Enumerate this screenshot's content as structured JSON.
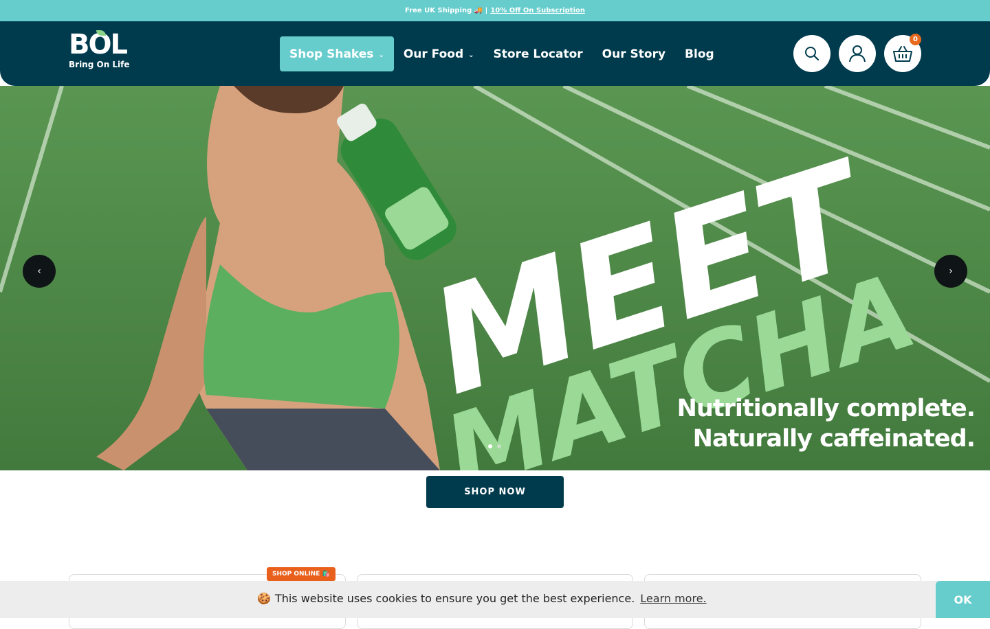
{
  "announcement": {
    "shipping": "Free UK Shipping 🚚 |",
    "subscription_link": "10% Off On Subscription"
  },
  "logo": {
    "big": "BOL",
    "small": "Bring On Life"
  },
  "nav": {
    "items": [
      {
        "label": "Shop Shakes",
        "has_dropdown": true,
        "active": true
      },
      {
        "label": "Our Food",
        "has_dropdown": true,
        "active": false
      },
      {
        "label": "Store Locator",
        "has_dropdown": false,
        "active": false
      },
      {
        "label": "Our Story",
        "has_dropdown": false,
        "active": false
      },
      {
        "label": "Blog",
        "has_dropdown": false,
        "active": false
      }
    ],
    "chevron": "⌄"
  },
  "icons": {
    "search": "search-icon",
    "account": "user-icon",
    "cart": "basket-icon"
  },
  "cart": {
    "count": "0"
  },
  "hero": {
    "headline_1": "MEET",
    "headline_2": "MATCHA",
    "tagline_1": "Nutritionally complete.",
    "tagline_2": "Naturally caffeinated.",
    "prev": "‹",
    "next": "›",
    "slide_count": 2,
    "active_slide": 1
  },
  "cta": {
    "label": "SHOP NOW"
  },
  "cards": {
    "tag": "SHOP ONLINE 🛍️"
  },
  "cookie": {
    "emoji": "🍪",
    "message": "This website uses cookies to ensure you get the best experience.",
    "learn_more": "Learn more.",
    "ok": "OK"
  },
  "colors": {
    "teal": "#66cccc",
    "navy": "#003b4d",
    "orange": "#e8601c",
    "track_green": "#4e8a47",
    "matcha_green": "#9ad996"
  }
}
